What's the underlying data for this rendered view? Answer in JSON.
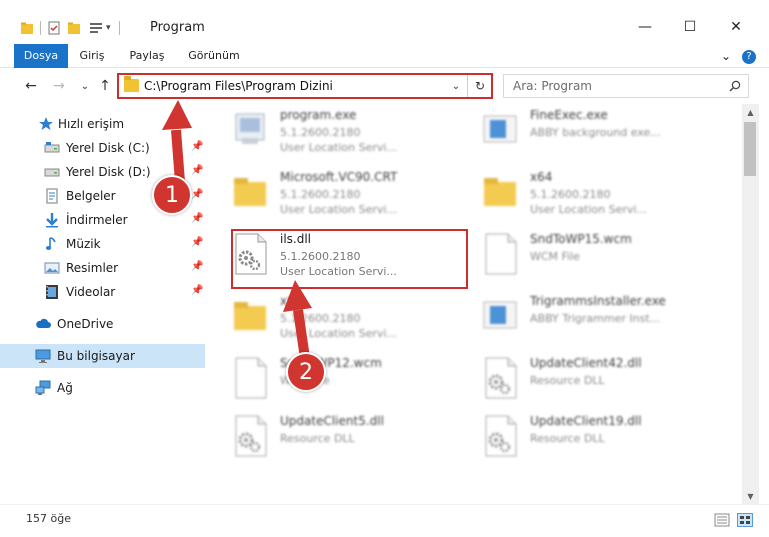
{
  "window": {
    "title": "Program",
    "minimize": "—",
    "maximize": "☐",
    "close": "✕"
  },
  "ribbon": {
    "tabs": [
      "Dosya",
      "Giriş",
      "Paylaş",
      "Görünüm"
    ],
    "active_tab": "Dosya",
    "expand": "⌄",
    "help": "?"
  },
  "navigation": {
    "back": "←",
    "forward": "→",
    "recent": "⌄",
    "up": "↑",
    "address": "C:\\Program Files\\Program Dizini",
    "address_dropdown": "⌄",
    "refresh": "↻",
    "search_placeholder": "Ara: Program"
  },
  "sidebar": {
    "quick_access": "Hızlı erişim",
    "pinned": [
      {
        "label": "Yerel Disk (C:)",
        "icon": "drive-icon"
      },
      {
        "label": "Yerel Disk (D:)",
        "icon": "drive-icon"
      },
      {
        "label": "Belgeler",
        "icon": "documents-icon"
      },
      {
        "label": "İndirmeler",
        "icon": "downloads-icon"
      },
      {
        "label": "Müzik",
        "icon": "music-icon"
      },
      {
        "label": "Resimler",
        "icon": "pictures-icon"
      },
      {
        "label": "Videolar",
        "icon": "videos-icon"
      }
    ],
    "pin_glyph": "📌",
    "onedrive": "OneDrive",
    "this_pc": "Bu bilgisayar",
    "network": "Ağ"
  },
  "files": [
    {
      "name": "program.exe",
      "version": "5.1.2600.2180",
      "desc": "User Location Servi...",
      "icon": "exe-icon",
      "blurred": true
    },
    {
      "name": "FineExec.exe",
      "version": "ABBY background exe...",
      "desc": "",
      "icon": "app-icon",
      "blurred": true
    },
    {
      "name": "Microsoft.VC90.CRT",
      "version": "5.1.2600.2180",
      "desc": "User Location Servi...",
      "icon": "folder-icon",
      "blurred": true
    },
    {
      "name": "x64",
      "version": "5.1.2600.2180",
      "desc": "User Location Servi...",
      "icon": "folder-icon",
      "blurred": true
    },
    {
      "name": "ils.dll",
      "version": "5.1.2600.2180",
      "desc": "User Location Servi...",
      "icon": "dll-icon",
      "blurred": false
    },
    {
      "name": "SndToWP15.wcm",
      "version": "WCM File",
      "desc": "",
      "icon": "file-icon",
      "blurred": true
    },
    {
      "name": "x86",
      "version": "5.1.2600.2180",
      "desc": "User Location Servi...",
      "icon": "folder-icon",
      "blurred": true
    },
    {
      "name": "TrigrammsInstaller.exe",
      "version": "ABBY Trigrammer Inst...",
      "desc": "",
      "icon": "app-icon",
      "blurred": true
    },
    {
      "name": "SndToWP12.wcm",
      "version": "WCM File",
      "desc": "",
      "icon": "file-icon",
      "blurred": true
    },
    {
      "name": "UpdateClient42.dll",
      "version": "Resource DLL",
      "desc": "",
      "icon": "dll-icon",
      "blurred": true
    },
    {
      "name": "UpdateClient5.dll",
      "version": "Resource DLL",
      "desc": "",
      "icon": "dll-icon",
      "blurred": true
    },
    {
      "name": "UpdateClient19.dll",
      "version": "Resource DLL",
      "desc": "",
      "icon": "dll-icon",
      "blurred": true
    }
  ],
  "status": {
    "count": "157 öğe"
  },
  "markers": [
    "1",
    "2"
  ],
  "colors": {
    "accent": "#1a73c9",
    "highlight": "#cc2e2e",
    "marker": "#d0352f",
    "selected": "#cce4f7"
  }
}
